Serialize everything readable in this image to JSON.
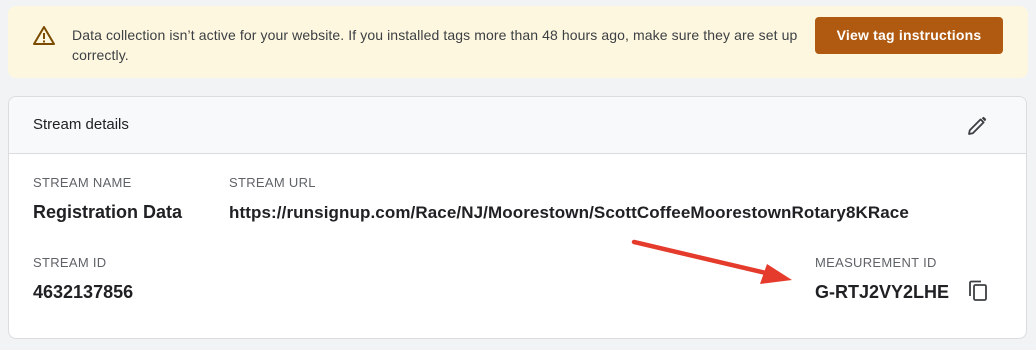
{
  "banner": {
    "message": "Data collection isn’t active for your website. If you installed tags more than 48 hours ago, make sure they are set up correctly.",
    "button_label": "View tag instructions",
    "icon": "warning-icon",
    "accent_color": "#b05a11",
    "background_color": "#fef7e0"
  },
  "stream_details": {
    "title": "Stream details",
    "edit_icon": "pencil-icon",
    "stream_name": {
      "label": "STREAM NAME",
      "value": "Registration Data"
    },
    "stream_url": {
      "label": "STREAM URL",
      "value": "https://runsignup.com/Race/NJ/Moorestown/ScottCoffeeMoorestownRotary8KRace"
    },
    "stream_id": {
      "label": "STREAM ID",
      "value": "4632137856"
    },
    "measurement_id": {
      "label": "MEASUREMENT ID",
      "value": "G-RTJ2VY2LHE",
      "copy_icon": "copy-icon"
    }
  },
  "annotation": {
    "arrow_color": "#e53b2c"
  }
}
